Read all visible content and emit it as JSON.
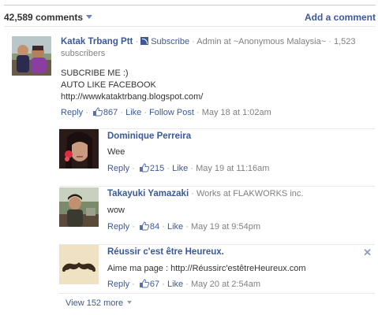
{
  "header": {
    "comment_count": "42,589 comments",
    "add_comment": "Add a comment"
  },
  "comments": [
    {
      "author": "Katak Trbang Ptt",
      "subscribe": "Subscribe",
      "meta": "Admin at ~Anonymous Malaysia~",
      "subscribers": "1,523 subscribers",
      "lines": [
        "SUBCRIBE ME :)",
        "AUTO LIKE FACEBOOK",
        "http://wwwkataktrbang.blogspot.com/"
      ],
      "reply": "Reply",
      "likes": "867",
      "like": "Like",
      "follow": "Follow Post",
      "time": "May 18 at 1:02am"
    },
    {
      "author": "Dominique Perreira",
      "text": "Wee",
      "reply": "Reply",
      "likes": "215",
      "like": "Like",
      "time": "May 19 at 11:16am"
    },
    {
      "author": "Takayuki Yamazaki",
      "meta": "Works at FLAKWORKS inc.",
      "text": "wow",
      "reply": "Reply",
      "likes": "84",
      "like": "Like",
      "time": "May 19 at 9:54pm"
    },
    {
      "author": "Réussir c'est être Heureux.",
      "text": "Aime ma page : http://Réussirc'estêtreHeureux.com",
      "reply": "Reply",
      "likes": "67",
      "like": "Like",
      "time": "May 20 at 2:54am"
    }
  ],
  "footer": {
    "view_more": "View 152 more"
  },
  "colors": {
    "link": "#3b5998",
    "text": "#333333",
    "muted": "#808080"
  }
}
